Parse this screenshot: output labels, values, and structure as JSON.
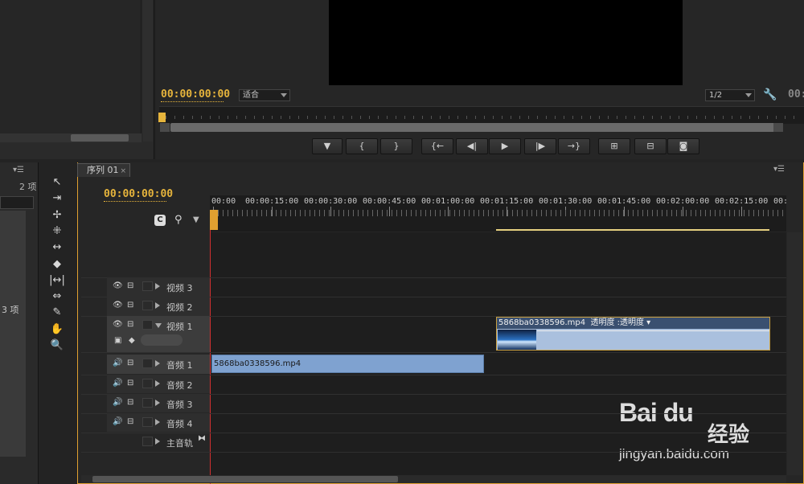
{
  "monitor": {
    "timecode": "00:00:00:00",
    "fit_select": "适合",
    "resolution_select": "1/2",
    "timecode_right": "00:",
    "transport_buttons": [
      {
        "icon": "add-marker-icon",
        "glyph": "▼"
      },
      {
        "icon": "mark-in-icon",
        "glyph": "{"
      },
      {
        "icon": "mark-out-icon",
        "glyph": "}"
      },
      {
        "icon": "go-to-in-icon",
        "glyph": "{←"
      },
      {
        "icon": "step-back-icon",
        "glyph": "◀|"
      },
      {
        "icon": "play-icon",
        "glyph": "▶"
      },
      {
        "icon": "step-forward-icon",
        "glyph": "|▶"
      },
      {
        "icon": "go-to-out-icon",
        "glyph": "→}"
      },
      {
        "icon": "lift-icon",
        "glyph": "⊞"
      },
      {
        "icon": "extract-icon",
        "glyph": "⊟"
      },
      {
        "icon": "export-frame-icon",
        "glyph": "◙"
      }
    ]
  },
  "project": {
    "item_count_top": "2 项",
    "item_count_bottom": "3 项"
  },
  "sequence": {
    "tab_label": "序列 01",
    "tab_close": "×",
    "timecode": "00:00:00:00",
    "ruler_labels": [
      "00:00",
      "00:00:15:00",
      "00:00:30:00",
      "00:00:45:00",
      "00:01:00:00",
      "00:01:15:00",
      "00:01:30:00",
      "00:01:45:00",
      "00:02:00:00",
      "00:02:15:00",
      "00:"
    ],
    "video_tracks": [
      {
        "name": "视频 3"
      },
      {
        "name": "视频 2"
      },
      {
        "name": "视频 1"
      }
    ],
    "audio_tracks": [
      {
        "name": "音频 1"
      },
      {
        "name": "音频 2"
      },
      {
        "name": "音频 3"
      },
      {
        "name": "音频 4"
      }
    ],
    "master_track": "主音轨",
    "video_clip": {
      "filename": "5868ba0338596.mp4",
      "effect": "透明度 :透明度 ▾"
    },
    "audio_clip": {
      "filename": "5868ba0338596.mp4"
    }
  },
  "tools": [
    {
      "icon": "selection-tool-icon",
      "glyph": "↖"
    },
    {
      "icon": "track-select-tool-icon",
      "glyph": "⇥"
    },
    {
      "icon": "ripple-edit-tool-icon",
      "glyph": "✢"
    },
    {
      "icon": "rolling-edit-tool-icon",
      "glyph": "⁜"
    },
    {
      "icon": "rate-stretch-tool-icon",
      "glyph": "↔"
    },
    {
      "icon": "razor-tool-icon",
      "glyph": "◆"
    },
    {
      "icon": "slip-tool-icon",
      "glyph": "|↔|"
    },
    {
      "icon": "slide-tool-icon",
      "glyph": "⇔"
    },
    {
      "icon": "pen-tool-icon",
      "glyph": "✎"
    },
    {
      "icon": "hand-tool-icon",
      "glyph": "✋"
    },
    {
      "icon": "zoom-tool-icon",
      "glyph": "🔍"
    }
  ],
  "watermark": {
    "logo": "Bai du",
    "logo_cn": "经验",
    "url": "jingyan.baidu.com"
  }
}
